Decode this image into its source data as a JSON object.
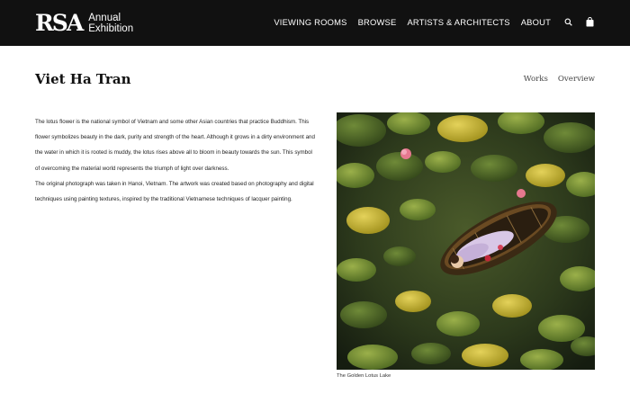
{
  "header": {
    "logo_mark": "RSA",
    "logo_line1": "Annual",
    "logo_line2": "Exhibition",
    "nav": [
      "VIEWING ROOMS",
      "BROWSE",
      "ARTISTS & ARCHITECTS",
      "ABOUT"
    ],
    "icons": [
      "search-icon",
      "shopping-bag-icon"
    ]
  },
  "artist": {
    "name": "Viet Ha Tran",
    "tabs": [
      "Works",
      "Overview"
    ]
  },
  "description": {
    "paragraph1": "The lotus flower is the national symbol of Vietnam and some other Asian countries that practice Buddhism. This flower symbolizes beauty in the dark, purity and strength of the heart. Although it grows in a dirty environment and the water in which it is rooted is muddy, the lotus rises above all to bloom in beauty towards the sun. This symbol of overcoming the material world represents the triumph of light over darkness.",
    "paragraph2": "The original photograph was taken in Hanoi, Vietnam. The artwork was created based on photography and digital techniques using painting textures, inspired by the traditional Vietnamese techniques of lacquer painting."
  },
  "artwork": {
    "caption": "The Golden Lotus Lake"
  }
}
